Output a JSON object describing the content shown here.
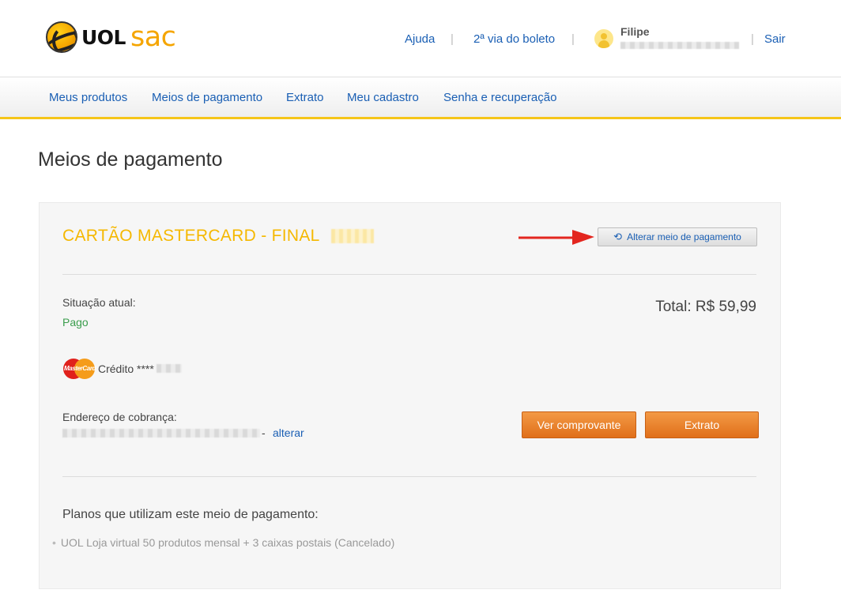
{
  "header": {
    "logo_uol": "UOL",
    "logo_sac": "sac",
    "nav": {
      "help": "Ajuda",
      "boleto": "2ª via do boleto",
      "logout": "Sair"
    },
    "separator": "|",
    "user": {
      "name": "Filipe"
    }
  },
  "menu": {
    "items": [
      {
        "label": "Meus produtos"
      },
      {
        "label": "Meios de pagamento"
      },
      {
        "label": "Extrato"
      },
      {
        "label": "Meu cadastro"
      },
      {
        "label": "Senha e recuperação"
      }
    ]
  },
  "page": {
    "title": "Meios de pagamento"
  },
  "payment": {
    "card_title": "CARTÃO MASTERCARD - FINAL",
    "change_button": "Alterar meio de pagamento",
    "status_label": "Situação atual:",
    "status_value": "Pago",
    "total": "Total: R$ 59,99",
    "card_brand": "MasterCard",
    "credit_text": "Crédito ****",
    "billing_label": "Endereço de cobrança:",
    "address_dash": "-",
    "alterar": "alterar",
    "view_receipt_button": "Ver comprovante",
    "statement_button": "Extrato"
  },
  "plans": {
    "title": "Planos que utilizam este meio de pagamento:",
    "items": [
      {
        "text": "UOL Loja virtual 50 produtos mensal + 3 caixas postais (Cancelado)"
      }
    ]
  },
  "colors": {
    "link": "#1a5fb4",
    "accent_yellow": "#f5b800",
    "status_green": "#3a9d4c",
    "button_orange": "#e87d2a"
  }
}
